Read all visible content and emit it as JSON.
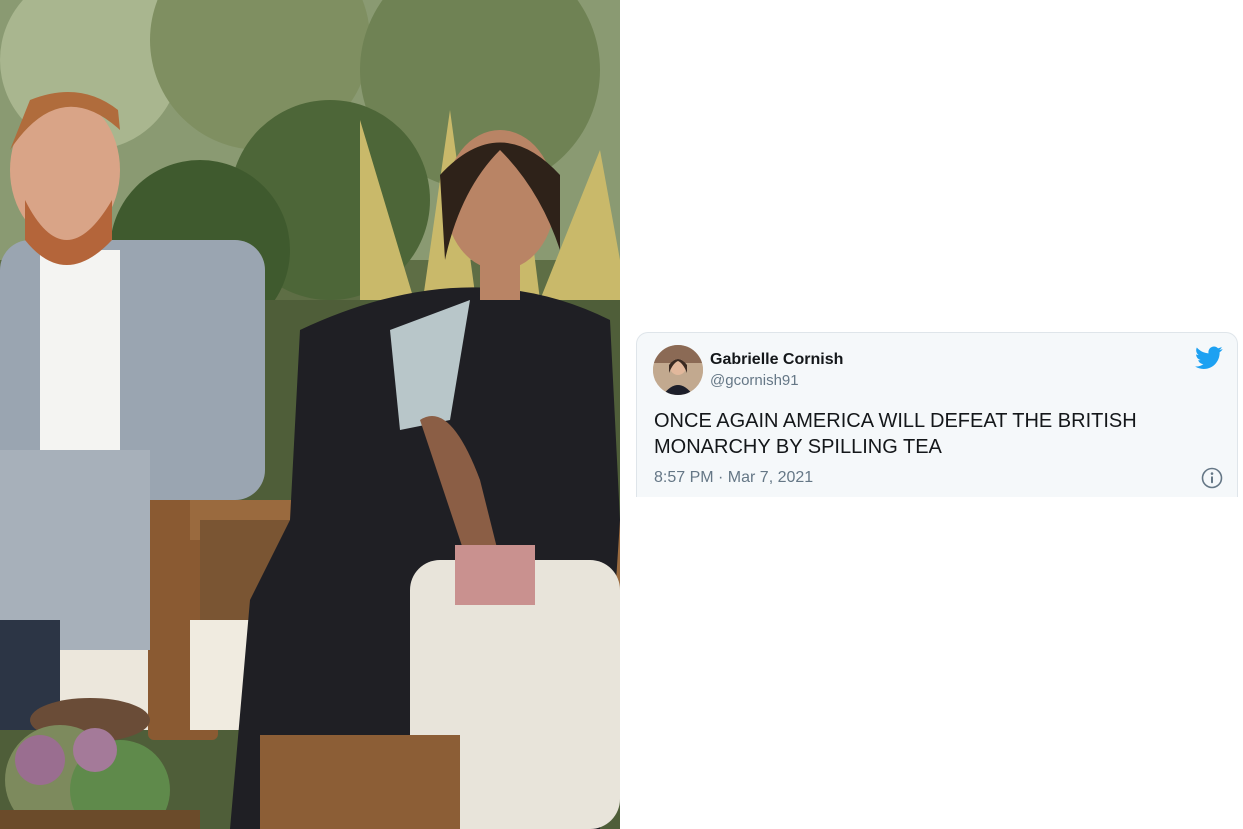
{
  "tweet": {
    "display_name": "Gabrielle Cornish",
    "handle": "@gcornish91",
    "text": "ONCE AGAIN AMERICA WILL DEFEAT THE BRITISH MONARCHY BY SPILLING TEA",
    "timestamp": "8:57 PM · Mar 7, 2021",
    "brand_icon": "twitter-bird-icon",
    "info_icon": "info-icon",
    "brand_color": "#1da1f2",
    "text_color": "#14171a",
    "muted_color": "#657786",
    "card_bg": "#f5f8fa"
  },
  "photo": {
    "description_icon": "interview-photo"
  }
}
